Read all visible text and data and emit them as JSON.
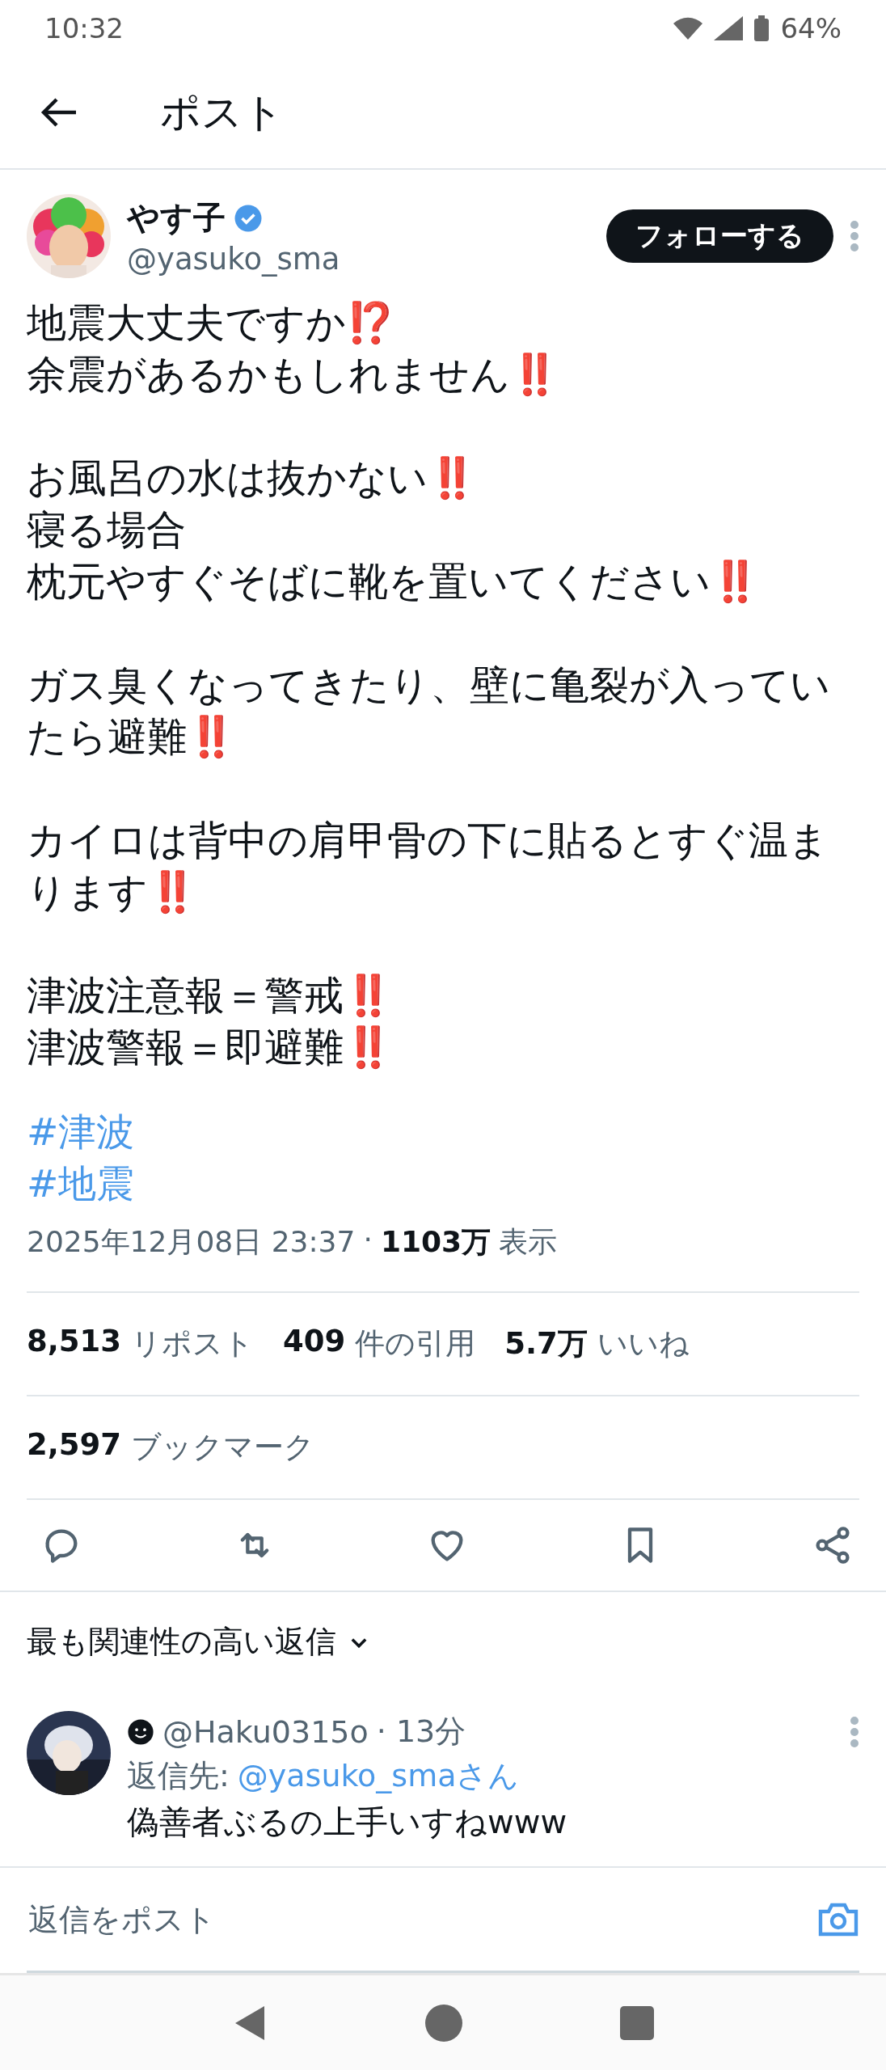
{
  "status_bar": {
    "time": "10:32",
    "battery": "64%"
  },
  "header": {
    "title": "ポスト"
  },
  "post": {
    "author": {
      "name": "やす子",
      "handle": "@yasuko_sma",
      "verified": true
    },
    "follow_button": "フォローする",
    "paragraphs": [
      [
        "地震大丈夫ですか⁉️",
        "余震があるかもしれません‼️"
      ],
      [
        "お風呂の水は抜かない‼️",
        "寝る場合",
        "枕元やすぐそばに靴を置いてください‼️"
      ],
      [
        "ガス臭くなってきたり、壁に亀裂が入っていたら避難‼️"
      ],
      [
        "カイロは背中の肩甲骨の下に貼るとすぐ温まります‼️"
      ],
      [
        "津波注意報＝警戒‼️",
        "津波警報＝即避難‼️"
      ]
    ],
    "hashtags": [
      "#津波",
      "#地震"
    ],
    "timestamp": "2025年12月08日 23:37",
    "meta_separator": "·",
    "views": {
      "count": "1103万",
      "label": "表示"
    },
    "stats": [
      {
        "count": "8,513",
        "label": "リポスト"
      },
      {
        "count": "409",
        "label": "件の引用"
      },
      {
        "count": "5.7万",
        "label": "いいね"
      }
    ],
    "bookmarks": {
      "count": "2,597",
      "label": "ブックマーク"
    }
  },
  "actions": [
    {
      "kind": "reply"
    },
    {
      "kind": "repost"
    },
    {
      "kind": "like"
    },
    {
      "kind": "bookmark"
    },
    {
      "kind": "share"
    }
  ],
  "replies": {
    "sort_label": "最も関連性の高い返信",
    "items": [
      {
        "handle": "@Haku0315o",
        "time": "· 13分",
        "reply_to_label": "返信先:",
        "reply_to": "@yasuko_smaさん",
        "text": "偽善者ぶるの上手いすねwww"
      }
    ]
  },
  "composer": {
    "placeholder": "返信をポスト"
  }
}
